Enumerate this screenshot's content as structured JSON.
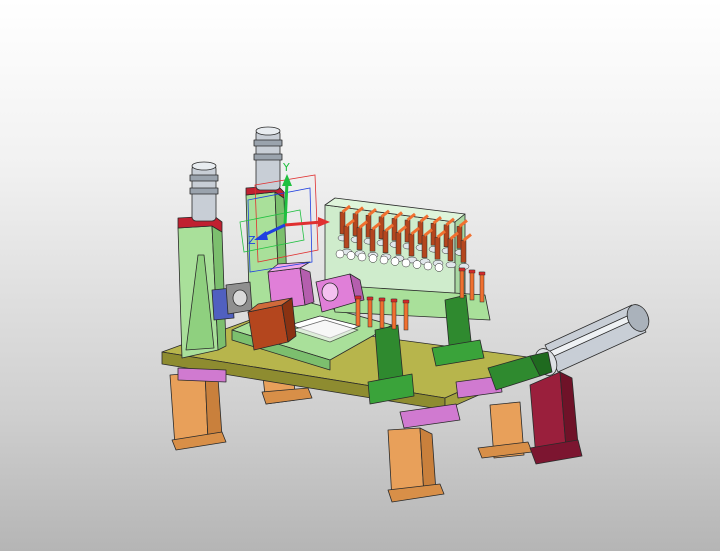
{
  "viewer": {
    "background_top": "#ffffff",
    "background_bottom": "#b5b5b5"
  },
  "colors": {
    "leg": "#e8a05a",
    "base_plate": "#b7b54c",
    "frame_green": "#a9e09a",
    "dark_green": "#2f8a2f",
    "dark_red": "#9a1f3c",
    "magenta": "#e07fd8",
    "red": "#d42a2a",
    "brown": "#b4461e",
    "silver": "#c8ced6",
    "orange_pin": "#f07030",
    "purple": "#d07ad0",
    "mint": "#cfeccc"
  },
  "triad": {
    "y_label": "Y",
    "z_label": "Z",
    "x_color": "#e03030",
    "y_color": "#20c040",
    "z_color": "#2040e0"
  }
}
